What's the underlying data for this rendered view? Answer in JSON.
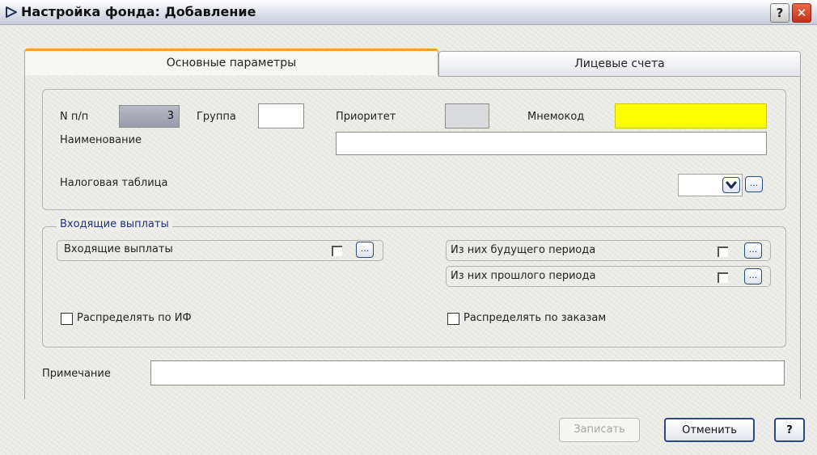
{
  "window": {
    "title": "Настройка фонда: Добавление",
    "help_button": "?",
    "close_button": "✕"
  },
  "tabs": [
    {
      "label": "Основные параметры",
      "active": true
    },
    {
      "label": "Лицевые счета",
      "active": false
    }
  ],
  "main": {
    "number_label": "N п/п",
    "number_value": "3",
    "group_label": "Группа",
    "group_value": "",
    "priority_label": "Приоритет",
    "priority_value": "",
    "mnemocode_label": "Мнемокод",
    "mnemocode_value": "",
    "mnemocode_color": "#ffff00",
    "name_label": "Наименование",
    "name_value": "",
    "tax_table_label": "Налоговая таблица",
    "tax_table_value": ""
  },
  "incoming": {
    "group_title": "Входящие выплаты",
    "incoming_payments_label": "Входящие выплаты",
    "future_period_label": "Из них будущего периода",
    "past_period_label": "Из них прошлого периода",
    "distribute_if_label": "Распределять по ИФ",
    "distribute_orders_label": "Распределять по заказам",
    "ellipsis": "..."
  },
  "note": {
    "label": "Примечание",
    "value": ""
  },
  "buttons": {
    "save": "Записать",
    "cancel": "Отменить",
    "help": "?"
  },
  "icons": {
    "title": "triangle-outline-icon",
    "dropdown": "chevron-down-icon"
  }
}
